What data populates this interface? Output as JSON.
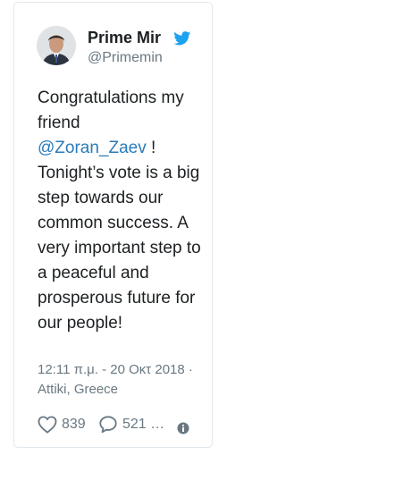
{
  "tweet": {
    "author": {
      "display_name": "Prime Mir",
      "handle": "@Primemin",
      "avatar_icon": "profile-photo",
      "verified_brand_icon": "twitter-bird-icon"
    },
    "text": {
      "line_1": "Congratulations my friend",
      "mention": "@Zoran_Zaev",
      "after_mention": " ! Tonight’s vote is a big step towards our common success. A very important step to a peaceful and prosperous future for our people!"
    },
    "meta": {
      "time": "12:11 π.μ. - 20 Οκτ 2018",
      "separator": " · ",
      "location": "Attiki, Greece"
    },
    "actions": {
      "like_count": "839",
      "reply_count": "521 …",
      "like_icon": "heart-icon",
      "reply_icon": "speech-bubble-icon",
      "info_icon": "info-icon"
    }
  },
  "colors": {
    "mention": "#2b7bb9",
    "muted": "#697882",
    "text": "#1c2022",
    "twitter_blue": "#1da1f2"
  }
}
